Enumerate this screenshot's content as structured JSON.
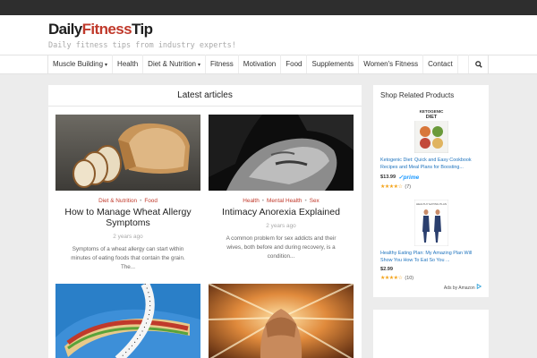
{
  "site": {
    "logo_part1": "Daily",
    "logo_part2": "Fitness",
    "logo_part3": "Tip",
    "tagline": "Daily fitness tips from industry experts!"
  },
  "nav": {
    "items": [
      {
        "label": "Muscle Building",
        "dropdown": true
      },
      {
        "label": "Health",
        "dropdown": false
      },
      {
        "label": "Diet & Nutrition",
        "dropdown": true
      },
      {
        "label": "Fitness",
        "dropdown": false
      },
      {
        "label": "Motivation",
        "dropdown": false
      },
      {
        "label": "Food",
        "dropdown": false
      },
      {
        "label": "Supplements",
        "dropdown": false
      },
      {
        "label": "Women's Fitness",
        "dropdown": false
      },
      {
        "label": "Contact",
        "dropdown": false
      }
    ],
    "caret": "▾",
    "search_icon": "search-icon"
  },
  "main": {
    "title": "Latest articles",
    "posts": [
      {
        "cat1": "Diet & Nutrition",
        "cat2": "Food",
        "sep": "•",
        "title": "How to Manage Wheat Allergy Symptoms",
        "date": "2 years ago",
        "excerpt": "Symptoms of a wheat allergy can start within minutes of eating foods that contain the grain. The..."
      },
      {
        "cat1": "Health",
        "cat2": "Mental Health",
        "cat3": "Sex",
        "sep": "•",
        "title": "Intimacy Anorexia Explained",
        "date": "2 years ago",
        "excerpt": "A common problem for sex addicts and their wives, both before and during recovery, is a condition..."
      }
    ]
  },
  "sidebar": {
    "title": "Shop Related Products",
    "products": [
      {
        "cover_line1": "KETOGENIC",
        "cover_line2": "DIET",
        "title": "Ketogenic Diet: Quick and Easy Cookbook Recipes and Meal Plans for Boosting...",
        "price": "$13.99",
        "prime": "✓prime",
        "stars": "★★★★☆",
        "count": "(7)"
      },
      {
        "cover_line1": "HEALTHY EATING PLAN",
        "title": "Healthy Eating Plan: My Amazing Plan Will Show You How To Eat So You ...",
        "price": "$2.99",
        "stars": "★★★★☆",
        "count": "(10)"
      }
    ],
    "ads_by": "Ads by Amazon"
  }
}
